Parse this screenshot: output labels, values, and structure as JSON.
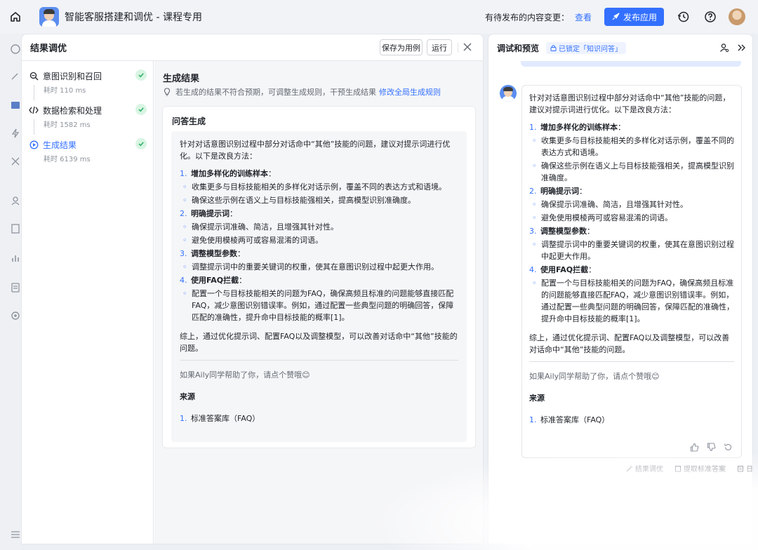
{
  "topbar": {
    "app_title": "智能客服搭建和调优 - 课程专用",
    "pending_text": "有待发布的内容变更：",
    "view_link": "查看",
    "publish_button": "发布应用"
  },
  "left_panel": {
    "title": "结果调优",
    "save_case_button": "保存为用例",
    "run_button": "运行",
    "steps": [
      {
        "label": "意图识别和召回",
        "time": "耗时 110 ms"
      },
      {
        "label": "数据检索和处理",
        "time": "耗时 1582 ms"
      },
      {
        "label": "生成结果",
        "time": "耗时 6139 ms"
      }
    ],
    "result_title": "生成结果",
    "result_hint": "若生成的结果不符合预期，可调整生成规则，干预生成结果",
    "result_hint_link": "修改全局生成规则",
    "card_title": "问答生成"
  },
  "answer": {
    "intro": "针对对话意图识别过程中部分对话命中“其他”技能的问题，建议对提示词进行优化。以下是改良方法：",
    "items": [
      {
        "num": "1.",
        "head": "增加多样化的训练样本",
        "subs": [
          "收集更多与目标技能相关的多样化对话示例，覆盖不同的表达方式和语境。",
          "确保这些示例在语义上与目标技能强相关，提高模型识别准确度。"
        ]
      },
      {
        "num": "2.",
        "head": "明确提示词",
        "subs": [
          "确保提示词准确、简洁，且增强其针对性。",
          "避免使用模棱两可或容易混淆的词语。"
        ]
      },
      {
        "num": "3.",
        "head": "调整模型参数",
        "subs": [
          "调整提示词中的重要关键词的权重，使其在意图识别过程中起更大作用。"
        ]
      },
      {
        "num": "4.",
        "head": "使用FAQ拦截",
        "subs": [
          "配置一个与目标技能相关的问题为FAQ，确保高频且标准的问题能够直接匹配FAQ，减少意图识别错误率。例如，通过配置一些典型问题的明确回答，保障匹配的准确性，提升命中目标技能的概率[1]。"
        ]
      }
    ],
    "conclusion": "综上，通过优化提示词、配置FAQ以及调整模型，可以改善对话命中“其他”技能的问题。",
    "thanks": "如果Aily同学帮助了你，请点个赞哦😊",
    "source_title": "来源",
    "source_num": "1.",
    "source_item": "标准答案库（FAQ）"
  },
  "right_panel": {
    "title": "调试和预览",
    "lock_badge": "已锁定「知识问答」",
    "foot_actions": [
      "结果调优",
      "提取标准答案",
      "日志"
    ]
  }
}
